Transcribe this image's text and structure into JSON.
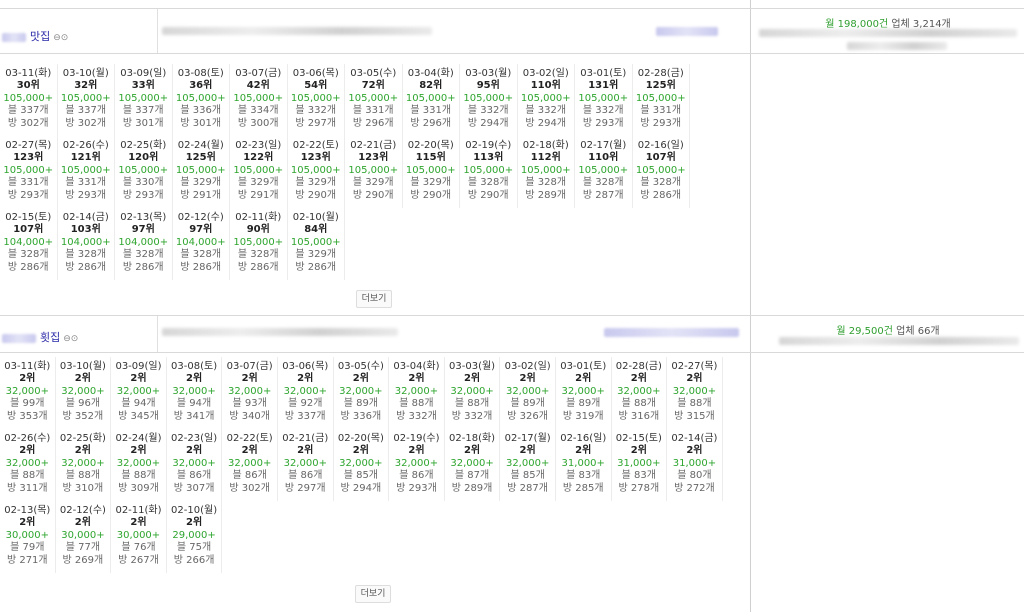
{
  "sections": [
    {
      "keyword": "맛집",
      "icons": "⊖⊙",
      "month_label": "월 198,000건",
      "business_label": "업체 3,214개",
      "more_label": "더보기",
      "cells": [
        {
          "date": "03-11(화)",
          "rank": "30위",
          "price": "105,000+",
          "blog": "블 337개",
          "bang": "방 302개"
        },
        {
          "date": "03-10(월)",
          "rank": "32위",
          "price": "105,000+",
          "blog": "블 337개",
          "bang": "방 302개"
        },
        {
          "date": "03-09(일)",
          "rank": "33위",
          "price": "105,000+",
          "blog": "블 337개",
          "bang": "방 301개"
        },
        {
          "date": "03-08(토)",
          "rank": "36위",
          "price": "105,000+",
          "blog": "블 336개",
          "bang": "방 301개"
        },
        {
          "date": "03-07(금)",
          "rank": "42위",
          "price": "105,000+",
          "blog": "블 334개",
          "bang": "방 300개"
        },
        {
          "date": "03-06(목)",
          "rank": "54위",
          "price": "105,000+",
          "blog": "블 332개",
          "bang": "방 297개"
        },
        {
          "date": "03-05(수)",
          "rank": "72위",
          "price": "105,000+",
          "blog": "블 331개",
          "bang": "방 296개"
        },
        {
          "date": "03-04(화)",
          "rank": "82위",
          "price": "105,000+",
          "blog": "블 331개",
          "bang": "방 296개"
        },
        {
          "date": "03-03(월)",
          "rank": "95위",
          "price": "105,000+",
          "blog": "블 332개",
          "bang": "방 294개"
        },
        {
          "date": "03-02(일)",
          "rank": "110위",
          "price": "105,000+",
          "blog": "블 332개",
          "bang": "방 294개"
        },
        {
          "date": "03-01(토)",
          "rank": "131위",
          "price": "105,000+",
          "blog": "블 332개",
          "bang": "방 293개"
        },
        {
          "date": "02-28(금)",
          "rank": "125위",
          "price": "105,000+",
          "blog": "블 331개",
          "bang": "방 293개"
        },
        {
          "date": "02-27(목)",
          "rank": "123위",
          "price": "105,000+",
          "blog": "블 331개",
          "bang": "방 293개"
        },
        {
          "date": "02-26(수)",
          "rank": "121위",
          "price": "105,000+",
          "blog": "블 331개",
          "bang": "방 293개"
        },
        {
          "date": "02-25(화)",
          "rank": "120위",
          "price": "105,000+",
          "blog": "블 330개",
          "bang": "방 293개"
        },
        {
          "date": "02-24(월)",
          "rank": "125위",
          "price": "105,000+",
          "blog": "블 329개",
          "bang": "방 291개"
        },
        {
          "date": "02-23(일)",
          "rank": "122위",
          "price": "105,000+",
          "blog": "블 329개",
          "bang": "방 291개"
        },
        {
          "date": "02-22(토)",
          "rank": "123위",
          "price": "105,000+",
          "blog": "블 329개",
          "bang": "방 290개"
        },
        {
          "date": "02-21(금)",
          "rank": "123위",
          "price": "105,000+",
          "blog": "블 329개",
          "bang": "방 290개"
        },
        {
          "date": "02-20(목)",
          "rank": "115위",
          "price": "105,000+",
          "blog": "블 329개",
          "bang": "방 290개"
        },
        {
          "date": "02-19(수)",
          "rank": "113위",
          "price": "105,000+",
          "blog": "블 328개",
          "bang": "방 290개"
        },
        {
          "date": "02-18(화)",
          "rank": "112위",
          "price": "105,000+",
          "blog": "블 328개",
          "bang": "방 289개"
        },
        {
          "date": "02-17(월)",
          "rank": "110위",
          "price": "105,000+",
          "blog": "블 328개",
          "bang": "방 287개"
        },
        {
          "date": "02-16(일)",
          "rank": "107위",
          "price": "105,000+",
          "blog": "블 328개",
          "bang": "방 286개"
        },
        {
          "date": "02-15(토)",
          "rank": "107위",
          "price": "104,000+",
          "blog": "블 328개",
          "bang": "방 286개"
        },
        {
          "date": "02-14(금)",
          "rank": "103위",
          "price": "104,000+",
          "blog": "블 328개",
          "bang": "방 286개"
        },
        {
          "date": "02-13(목)",
          "rank": "97위",
          "price": "104,000+",
          "blog": "블 328개",
          "bang": "방 286개"
        },
        {
          "date": "02-12(수)",
          "rank": "97위",
          "price": "104,000+",
          "blog": "블 328개",
          "bang": "방 286개"
        },
        {
          "date": "02-11(화)",
          "rank": "90위",
          "price": "105,000+",
          "blog": "블 328개",
          "bang": "방 286개"
        },
        {
          "date": "02-10(월)",
          "rank": "84위",
          "price": "105,000+",
          "blog": "블 329개",
          "bang": "방 286개"
        }
      ]
    },
    {
      "keyword": "횟집",
      "icons": "⊖⊙",
      "month_label": "월 29,500건",
      "business_label": "업체 66개",
      "more_label": "더보기",
      "cells": [
        {
          "date": "03-11(화)",
          "rank": "2위",
          "price": "32,000+",
          "blog": "블 99개",
          "bang": "방 353개"
        },
        {
          "date": "03-10(월)",
          "rank": "2위",
          "price": "32,000+",
          "blog": "블 96개",
          "bang": "방 352개"
        },
        {
          "date": "03-09(일)",
          "rank": "2위",
          "price": "32,000+",
          "blog": "블 94개",
          "bang": "방 345개"
        },
        {
          "date": "03-08(토)",
          "rank": "2위",
          "price": "32,000+",
          "blog": "블 94개",
          "bang": "방 341개"
        },
        {
          "date": "03-07(금)",
          "rank": "2위",
          "price": "32,000+",
          "blog": "블 93개",
          "bang": "방 340개"
        },
        {
          "date": "03-06(목)",
          "rank": "2위",
          "price": "32,000+",
          "blog": "블 92개",
          "bang": "방 337개"
        },
        {
          "date": "03-05(수)",
          "rank": "2위",
          "price": "32,000+",
          "blog": "블 89개",
          "bang": "방 336개"
        },
        {
          "date": "03-04(화)",
          "rank": "2위",
          "price": "32,000+",
          "blog": "블 88개",
          "bang": "방 332개"
        },
        {
          "date": "03-03(월)",
          "rank": "2위",
          "price": "32,000+",
          "blog": "블 88개",
          "bang": "방 332개"
        },
        {
          "date": "03-02(일)",
          "rank": "2위",
          "price": "32,000+",
          "blog": "블 89개",
          "bang": "방 326개"
        },
        {
          "date": "03-01(토)",
          "rank": "2위",
          "price": "32,000+",
          "blog": "블 89개",
          "bang": "방 319개"
        },
        {
          "date": "02-28(금)",
          "rank": "2위",
          "price": "32,000+",
          "blog": "블 88개",
          "bang": "방 316개"
        },
        {
          "date": "02-27(목)",
          "rank": "2위",
          "price": "32,000+",
          "blog": "블 88개",
          "bang": "방 315개"
        },
        {
          "date": "02-26(수)",
          "rank": "2위",
          "price": "32,000+",
          "blog": "블 88개",
          "bang": "방 311개"
        },
        {
          "date": "02-25(화)",
          "rank": "2위",
          "price": "32,000+",
          "blog": "블 88개",
          "bang": "방 310개"
        },
        {
          "date": "02-24(월)",
          "rank": "2위",
          "price": "32,000+",
          "blog": "블 88개",
          "bang": "방 309개"
        },
        {
          "date": "02-23(일)",
          "rank": "2위",
          "price": "32,000+",
          "blog": "블 86개",
          "bang": "방 307개"
        },
        {
          "date": "02-22(토)",
          "rank": "2위",
          "price": "32,000+",
          "blog": "블 86개",
          "bang": "방 302개"
        },
        {
          "date": "02-21(금)",
          "rank": "2위",
          "price": "32,000+",
          "blog": "블 86개",
          "bang": "방 297개"
        },
        {
          "date": "02-20(목)",
          "rank": "2위",
          "price": "32,000+",
          "blog": "블 85개",
          "bang": "방 294개"
        },
        {
          "date": "02-19(수)",
          "rank": "2위",
          "price": "32,000+",
          "blog": "블 86개",
          "bang": "방 293개"
        },
        {
          "date": "02-18(화)",
          "rank": "2위",
          "price": "32,000+",
          "blog": "블 87개",
          "bang": "방 289개"
        },
        {
          "date": "02-17(월)",
          "rank": "2위",
          "price": "32,000+",
          "blog": "블 85개",
          "bang": "방 287개"
        },
        {
          "date": "02-16(일)",
          "rank": "2위",
          "price": "31,000+",
          "blog": "블 83개",
          "bang": "방 285개"
        },
        {
          "date": "02-15(토)",
          "rank": "2위",
          "price": "31,000+",
          "blog": "블 83개",
          "bang": "방 278개"
        },
        {
          "date": "02-14(금)",
          "rank": "2위",
          "price": "31,000+",
          "blog": "블 80개",
          "bang": "방 272개"
        },
        {
          "date": "02-13(목)",
          "rank": "2위",
          "price": "30,000+",
          "blog": "블 79개",
          "bang": "방 271개"
        },
        {
          "date": "02-12(수)",
          "rank": "2위",
          "price": "30,000+",
          "blog": "블 77개",
          "bang": "방 269개"
        },
        {
          "date": "02-11(화)",
          "rank": "2위",
          "price": "30,000+",
          "blog": "블 76개",
          "bang": "방 267개"
        },
        {
          "date": "02-10(월)",
          "rank": "2위",
          "price": "29,000+",
          "blog": "블 75개",
          "bang": "방 266개"
        }
      ]
    }
  ]
}
